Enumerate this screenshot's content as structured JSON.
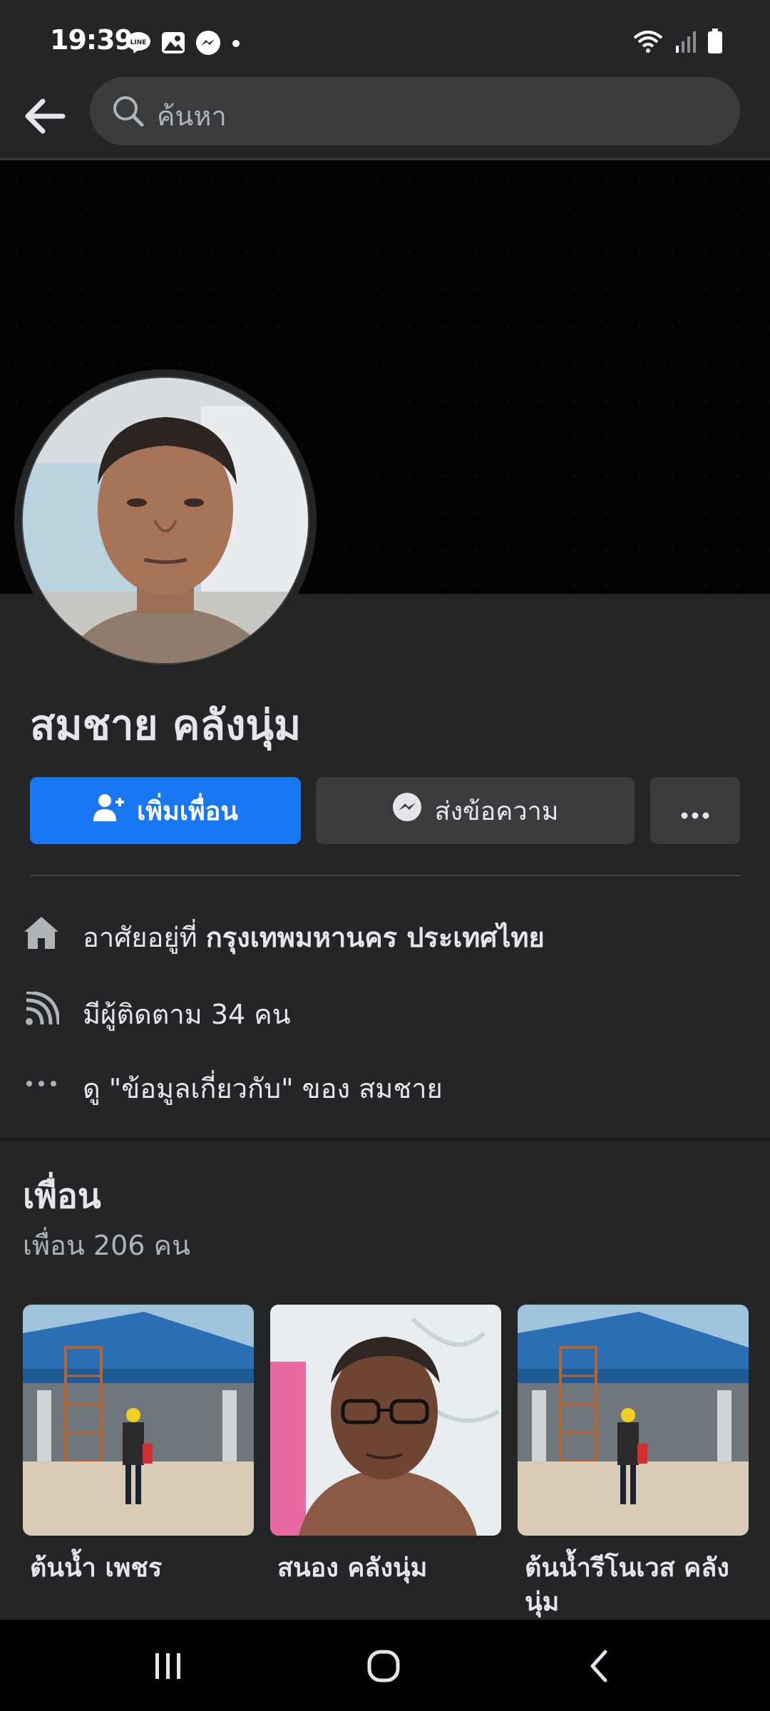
{
  "status_bar": {
    "time": "19:39",
    "notification_icons": [
      "line-icon",
      "gallery-icon",
      "messenger-icon",
      "dot-icon"
    ],
    "system_icons": [
      "wifi-icon",
      "signal-icon",
      "battery-icon"
    ]
  },
  "search": {
    "placeholder": "ค้นหา"
  },
  "profile": {
    "name": "สมชาย คลังนุ่ม"
  },
  "actions": {
    "add_friend": "เพิ่มเพื่อน",
    "message": "ส่งข้อความ"
  },
  "details": {
    "lives_prefix": "อาศัยอยู่ที่ ",
    "lives_place": "กรุงเทพมหานคร ประเทศไทย",
    "followers": "มีผู้ติดตาม 34 คน",
    "about": "ดู \"ข้อมูลเกี่ยวกับ\" ของ สมชาย"
  },
  "friends": {
    "title": "เพื่อน",
    "count": "เพื่อน 206 คน",
    "items": [
      {
        "name": "ต้นน้ำ เพชร"
      },
      {
        "name": "สนอง คลังนุ่ม"
      },
      {
        "name": "ต้นน้ำรีโนเวส คลังนุ่ม"
      }
    ]
  },
  "colors": {
    "background": "#242526",
    "primary_button": "#1877f2",
    "secondary_button": "#3a3b3c",
    "text_primary": "#e4e6eb",
    "text_secondary": "#b0b3b8"
  }
}
